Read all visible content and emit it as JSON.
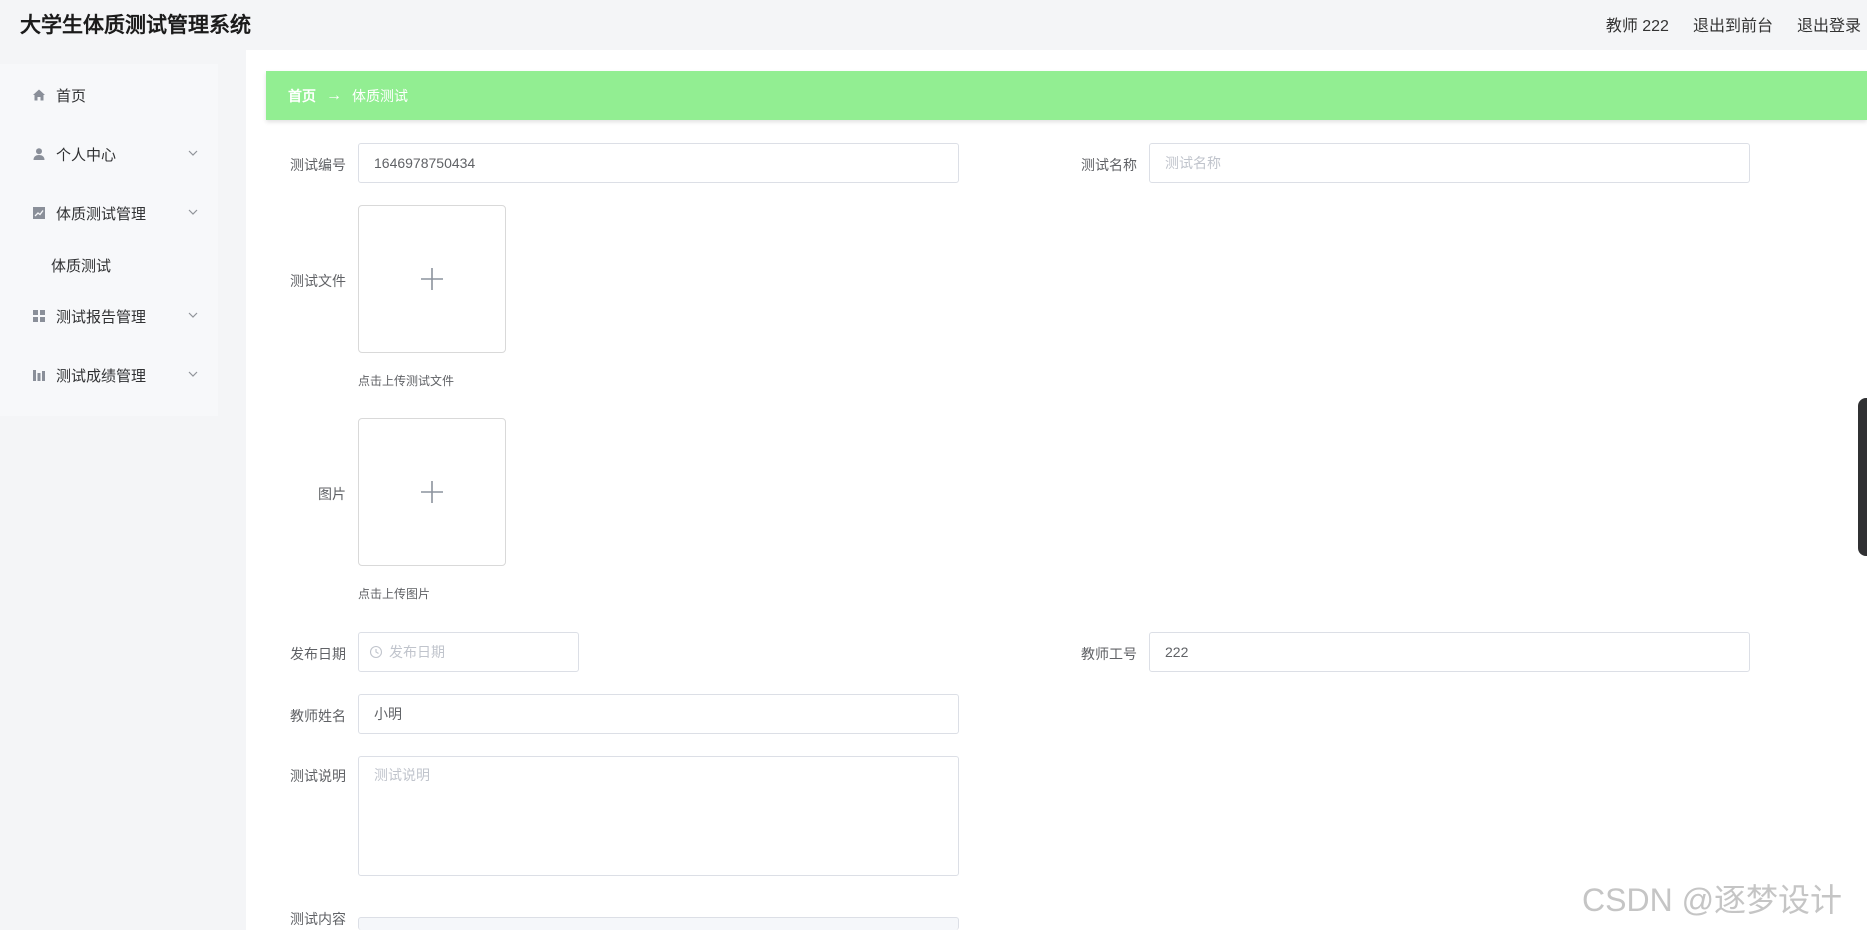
{
  "app": {
    "title": "大学生体质测试管理系统"
  },
  "header": {
    "user": "教师 222",
    "back_to_front": "退出到前台",
    "logout": "退出登录"
  },
  "sidebar": {
    "items": [
      {
        "label": "首页",
        "icon": "home-icon"
      },
      {
        "label": "个人中心",
        "icon": "user-icon"
      },
      {
        "label": "体质测试管理",
        "icon": "chart-icon"
      },
      {
        "label": "测试报告管理",
        "icon": "grid-icon"
      },
      {
        "label": "测试成绩管理",
        "icon": "bar-chart-icon"
      }
    ],
    "submenu": {
      "label": "体质测试"
    }
  },
  "breadcrumb": {
    "home": "首页",
    "arrow": "→",
    "current": "体质测试"
  },
  "form": {
    "test_no": {
      "label": "测试编号",
      "value": "1646978750434"
    },
    "test_name": {
      "label": "测试名称",
      "placeholder": "测试名称"
    },
    "test_file": {
      "label": "测试文件",
      "tip": "点击上传测试文件"
    },
    "image": {
      "label": "图片",
      "tip": "点击上传图片"
    },
    "publish_date": {
      "label": "发布日期",
      "placeholder": "发布日期"
    },
    "teacher_no": {
      "label": "教师工号",
      "value": "222"
    },
    "teacher_name": {
      "label": "教师姓名",
      "value": "小明"
    },
    "test_desc": {
      "label": "测试说明",
      "placeholder": "测试说明"
    },
    "test_content": {
      "label": "测试内容"
    }
  },
  "watermark": "CSDN @逐梦设计",
  "colors": {
    "accent": "#92ee92",
    "background": "#f4f5f7",
    "border": "#dcdfe6"
  }
}
